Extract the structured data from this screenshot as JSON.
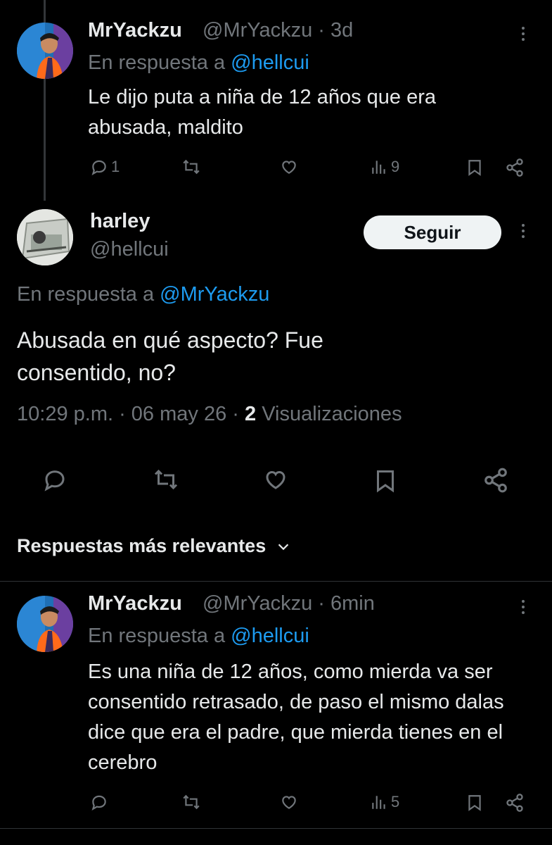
{
  "tweet1": {
    "name": "MrYackzu",
    "handle": "@MrYackzu",
    "separator": "·",
    "time": "3d",
    "reply_prefix": "En respuesta a",
    "reply_target": "@hellcui",
    "text": "Le dijo puta a niña de 12 años que era abusada, maldito",
    "replies": "1",
    "views": "9"
  },
  "main_tweet": {
    "name": "harley",
    "handle": "@hellcui",
    "follow_label": "Seguir",
    "reply_prefix": "En respuesta a",
    "reply_target": "@MrYackzu",
    "text": "Abusada en qué aspecto? Fue consentido, no?",
    "timestamp": "10:29 p.m. · 06 may 26 ·",
    "views_count": "2",
    "views_label": "Visualizaciones"
  },
  "replies_section": {
    "label": "Respuestas más relevantes"
  },
  "tweet2": {
    "name": "MrYackzu",
    "handle": "@MrYackzu",
    "separator": "·",
    "time": "6min",
    "reply_prefix": "En respuesta a",
    "reply_target": "@hellcui",
    "text": "Es una niña de 12 años, como mierda va ser consentido retrasado, de paso el mismo dalas dice que era el padre, que mierda tienes en el cerebro",
    "views": "5"
  },
  "icons": [
    "reply-icon",
    "retweet-icon",
    "like-icon",
    "views-icon",
    "bookmark-icon",
    "share-icon",
    "more-icon",
    "chevron-down-icon"
  ],
  "colors": {
    "background": "#000000",
    "text": "#e7e9ea",
    "muted": "#71767b",
    "link": "#1d9bf0",
    "follow_button": "#eff3f4"
  }
}
